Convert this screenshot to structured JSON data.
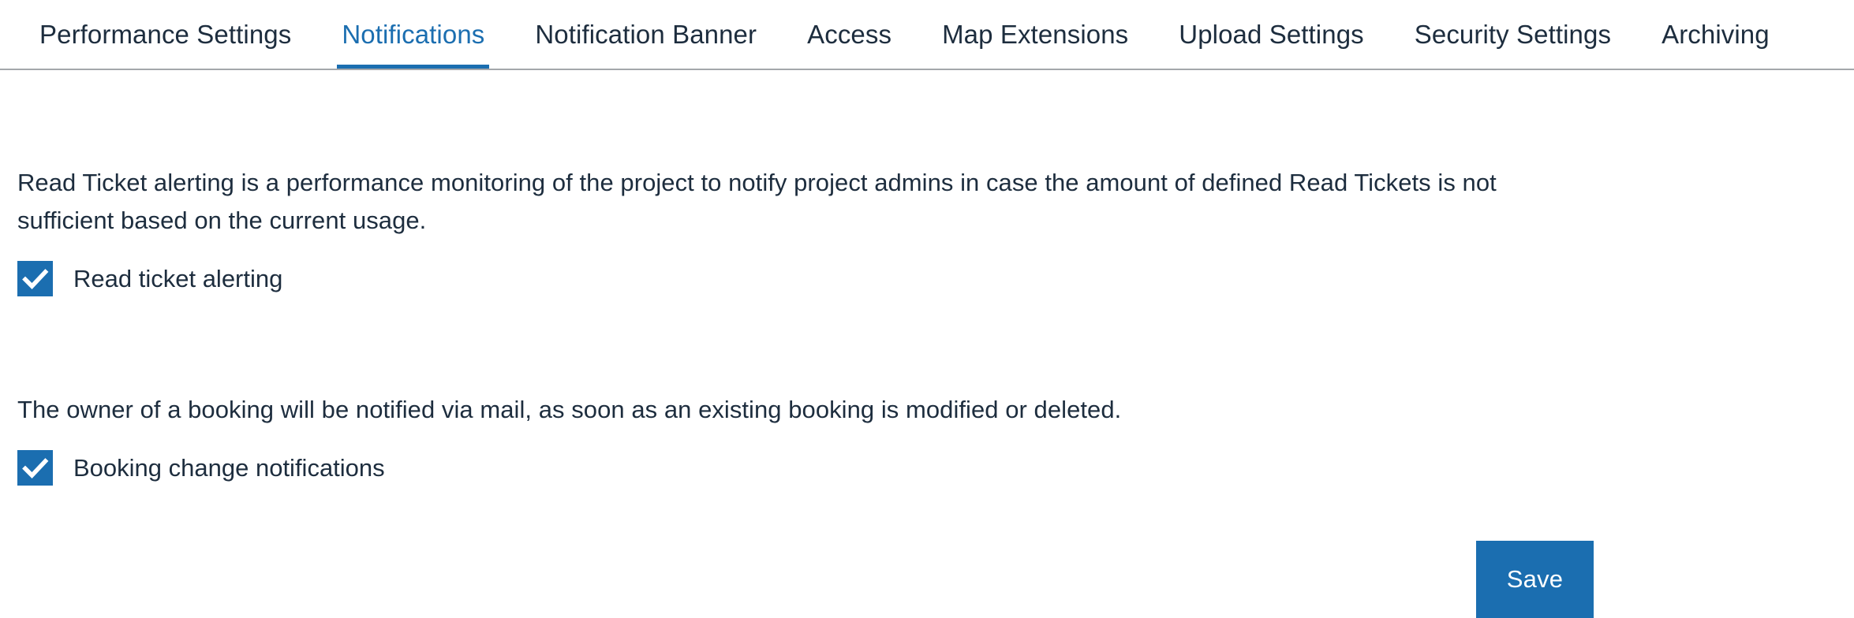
{
  "tabs": [
    {
      "label": "Performance Settings",
      "active": false
    },
    {
      "label": "Notifications",
      "active": true
    },
    {
      "label": "Notification Banner",
      "active": false
    },
    {
      "label": "Access",
      "active": false
    },
    {
      "label": "Map Extensions",
      "active": false
    },
    {
      "label": "Upload Settings",
      "active": false
    },
    {
      "label": "Security Settings",
      "active": false
    },
    {
      "label": "Archiving",
      "active": false
    }
  ],
  "sections": {
    "read_ticket": {
      "description": "Read Ticket alerting is a performance monitoring of the project to notify project admins in case the amount of defined Read Tickets is not sufficient based on the current usage.",
      "checkbox_label": "Read ticket alerting",
      "checked": true
    },
    "booking_change": {
      "description": "The owner of a booking will be notified via mail, as soon as an existing booking is modified or deleted.",
      "checkbox_label": "Booking change notifications",
      "checked": true
    }
  },
  "footer": {
    "save_label": "Save"
  },
  "icons": {
    "checkmark": "checkmark-icon"
  },
  "colors": {
    "accent_blue": "#1b6eb0",
    "text": "#1d2d3e",
    "divider_gray": "#a4a7ab",
    "background": "#ffffff",
    "checkmark_white": "#ffffff"
  }
}
